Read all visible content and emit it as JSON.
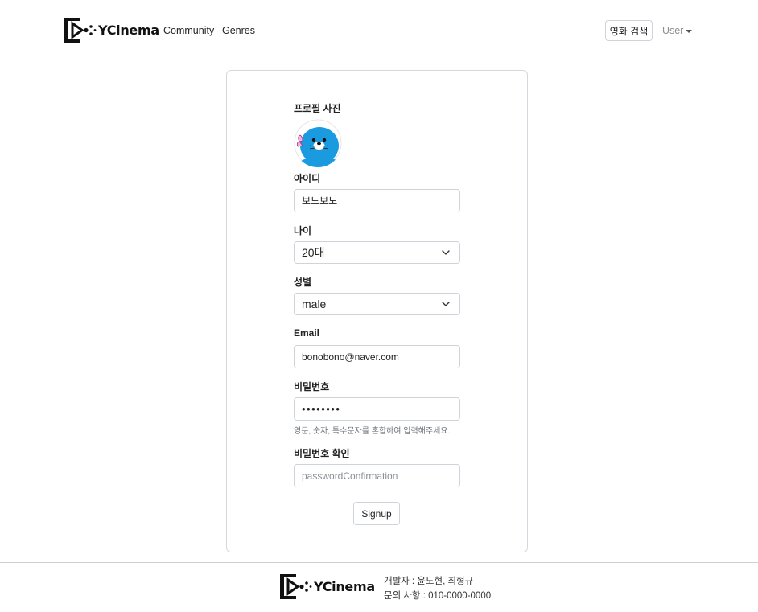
{
  "header": {
    "brand": "YCinema",
    "nav": [
      "Community",
      "Genres"
    ],
    "search_button": "영화 검색",
    "user_menu": "User"
  },
  "form": {
    "profile_label": "프로필 사진",
    "id_label": "아이디",
    "id_value": "보노보노",
    "age_label": "나이",
    "age_value": "20대",
    "gender_label": "성별",
    "gender_value": "male",
    "email_label": "Email",
    "email_value": "bonobono@naver.com",
    "password_label": "비밀번호",
    "password_value": "••••••••",
    "password_help": "영문, 숫자, 특수문자를 혼합하여 입력해주세요.",
    "confirm_label": "비밀번호 확인",
    "confirm_placeholder": "passwordConfirmation",
    "submit_label": "Signup"
  },
  "footer": {
    "brand": "YCinema",
    "developers": "개발자 : 윤도현, 최형규",
    "contact": "문의 사항 : 010-0000-0000"
  },
  "icons": {
    "logo": "play-film-logo-icon",
    "dropdown": "chevron-down-icon",
    "avatar": "seal-avatar"
  }
}
